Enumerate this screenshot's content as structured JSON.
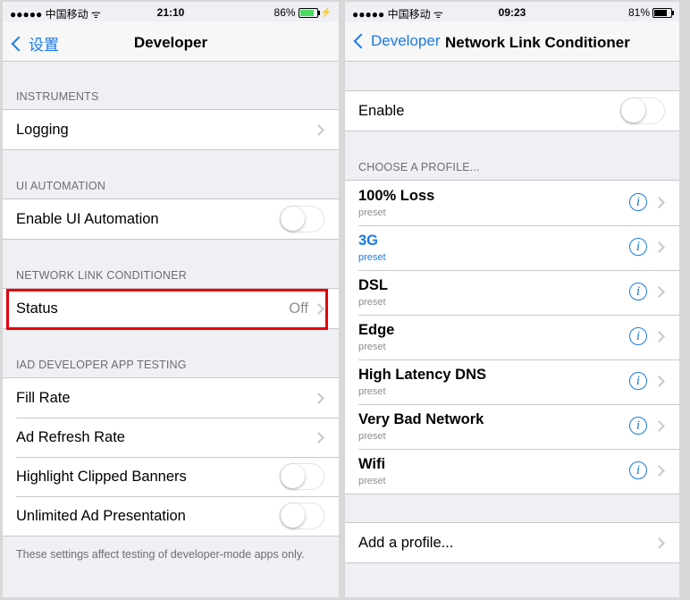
{
  "left": {
    "status_bar": {
      "signal": "●●●●● 中国移动 ᯤ",
      "time": "21:10",
      "battery": "86%",
      "battery_fill": 0.86,
      "battery_color": "#4cd964"
    },
    "nav": {
      "back_label": "设置",
      "title": "Developer"
    },
    "sections": {
      "instruments": {
        "header": "INSTRUMENTS",
        "logging": "Logging"
      },
      "ui_automation": {
        "header": "UI AUTOMATION",
        "enable": "Enable UI Automation"
      },
      "nlc": {
        "header": "NETWORK LINK CONDITIONER",
        "status_label": "Status",
        "status_value": "Off"
      },
      "iad": {
        "header": "IAD DEVELOPER APP TESTING",
        "fill_rate": "Fill Rate",
        "ad_refresh": "Ad Refresh Rate",
        "highlight_clipped": "Highlight Clipped Banners",
        "unlimited_ad": "Unlimited Ad Presentation",
        "footer": "These settings affect testing of developer-mode apps only."
      }
    },
    "highlight_color": "#e3000b"
  },
  "right": {
    "status_bar": {
      "signal": "●●●●● 中国移动 ᯤ",
      "time": "09:23",
      "battery": "81%",
      "battery_fill": 0.81,
      "battery_color": "#000000"
    },
    "nav": {
      "back_label": "Developer",
      "title": "Network Link Conditioner"
    },
    "enable_label": "Enable",
    "choose_header": "CHOOSE A PROFILE...",
    "profiles": [
      {
        "name": "100% Loss",
        "sub": "preset"
      },
      {
        "name": "3G",
        "sub": "preset",
        "selected": true
      },
      {
        "name": "DSL",
        "sub": "preset"
      },
      {
        "name": "Edge",
        "sub": "preset"
      },
      {
        "name": "High Latency DNS",
        "sub": "preset"
      },
      {
        "name": "Very Bad Network",
        "sub": "preset"
      },
      {
        "name": "Wifi",
        "sub": "preset"
      }
    ],
    "add_profile": "Add a profile...",
    "info_glyph": "i"
  },
  "colors": {
    "accent": "#1a7ae8",
    "background": "#efeff4"
  }
}
